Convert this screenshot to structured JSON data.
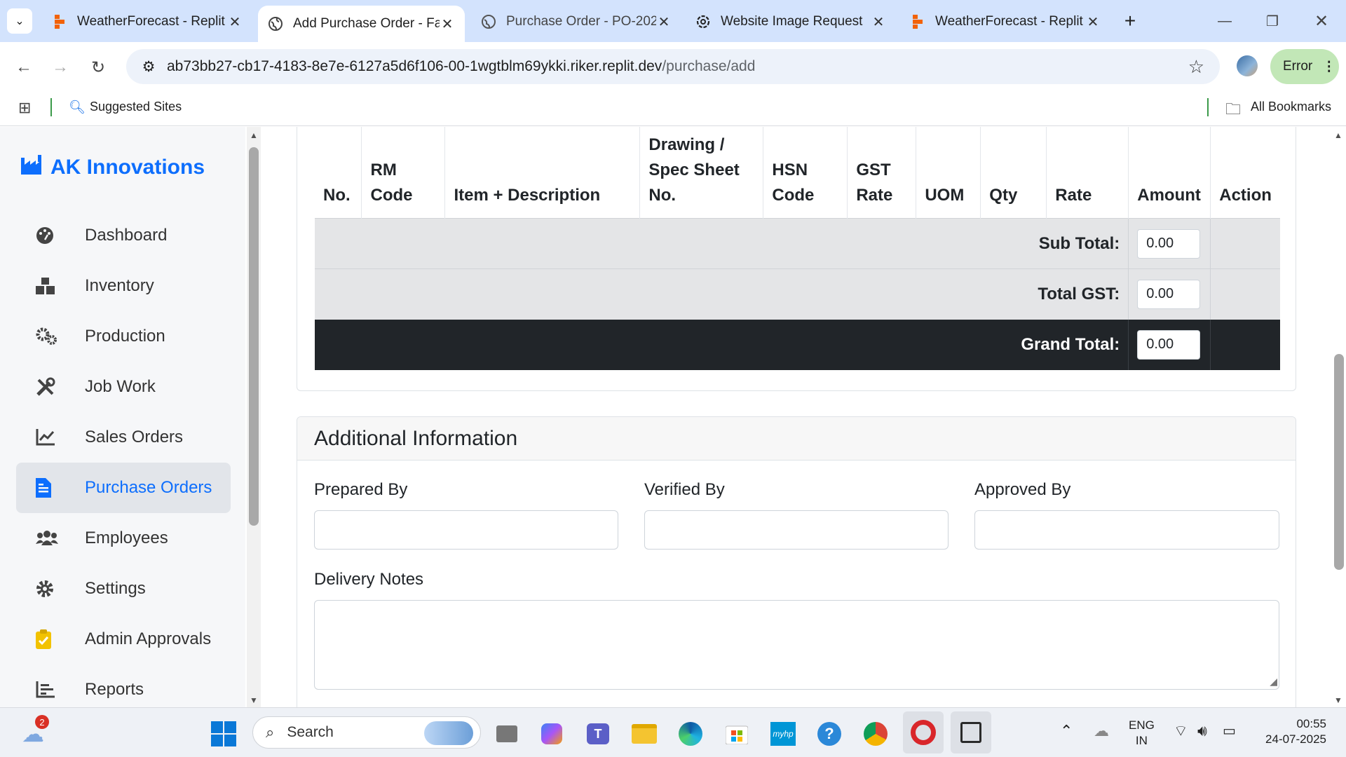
{
  "browser": {
    "tabs": [
      {
        "title": "WeatherForecast - Replit",
        "active": false,
        "favicon": "replit-icon"
      },
      {
        "title": "Add Purchase Order - Fac",
        "active": true,
        "favicon": "globe-icon"
      },
      {
        "title": "Purchase Order - PO-202",
        "active": false,
        "favicon": "globe-icon"
      },
      {
        "title": "Website Image Request",
        "active": false,
        "favicon": "openai-icon"
      },
      {
        "title": "WeatherForecast - Replit",
        "active": false,
        "favicon": "replit-icon"
      }
    ],
    "url_host": "ab73bb27-cb17-4183-8e7e-6127a5d6f106-00-1wgtblm69ykki.riker.replit.dev",
    "url_path": "/purchase/add",
    "error_label": "Error",
    "bookmarks": {
      "suggested": "Suggested Sites",
      "all": "All Bookmarks"
    }
  },
  "sidebar": {
    "brand": "AK Innovations",
    "items": [
      {
        "label": "Dashboard",
        "icon": "palette-icon",
        "active": false
      },
      {
        "label": "Inventory",
        "icon": "boxes-icon",
        "active": false
      },
      {
        "label": "Production",
        "icon": "cogs-icon",
        "active": false
      },
      {
        "label": "Job Work",
        "icon": "tools-icon",
        "active": false
      },
      {
        "label": "Sales Orders",
        "icon": "line-chart-icon",
        "active": false
      },
      {
        "label": "Purchase Orders",
        "icon": "document-icon",
        "active": true
      },
      {
        "label": "Employees",
        "icon": "users-icon",
        "active": false
      },
      {
        "label": "Settings",
        "icon": "gear-icon",
        "active": false
      },
      {
        "label": "Admin Approvals",
        "icon": "clipboard-check-icon",
        "active": false
      },
      {
        "label": "Reports",
        "icon": "bar-chart-icon",
        "active": false
      }
    ]
  },
  "items_table": {
    "headers": [
      "No.",
      "RM Code",
      "Item + Description",
      "Drawing / Spec Sheet No.",
      "HSN Code",
      "GST Rate",
      "UOM",
      "Qty",
      "Rate",
      "Amount",
      "Action"
    ],
    "sub_total_label": "Sub Total:",
    "sub_total_value": "0.00",
    "total_gst_label": "Total GST:",
    "total_gst_value": "0.00",
    "grand_total_label": "Grand Total:",
    "grand_total_value": "0.00"
  },
  "additional_info": {
    "title": "Additional Information",
    "prepared_by_label": "Prepared By",
    "prepared_by_value": "",
    "verified_by_label": "Verified By",
    "verified_by_value": "",
    "approved_by_label": "Approved By",
    "approved_by_value": "",
    "delivery_notes_label": "Delivery Notes",
    "delivery_notes_value": ""
  },
  "taskbar": {
    "search_placeholder": "Search",
    "weather_badge": "2",
    "language": "ENG",
    "region": "IN",
    "time": "00:55",
    "date": "24-07-2025"
  },
  "colors": {
    "primary": "#0d6efd",
    "grand_total_bg": "#212529",
    "tab_strip": "#d3e3fd",
    "error_pill": "#c2e7b7"
  }
}
